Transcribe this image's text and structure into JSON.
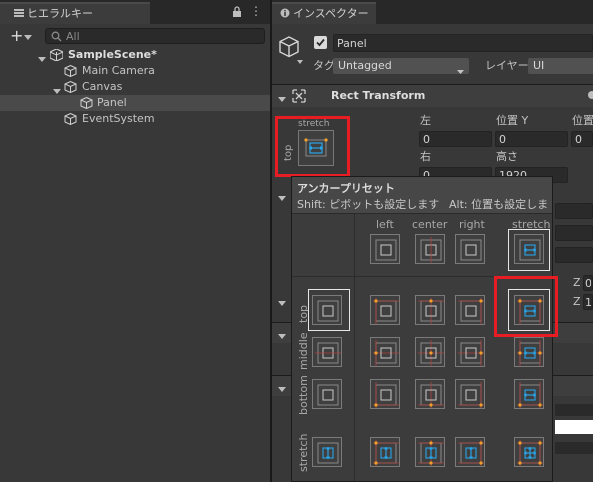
{
  "hierarchy": {
    "tab": "ヒエラルキー",
    "search_placeholder": "All",
    "items": [
      {
        "label": "SampleScene*"
      },
      {
        "label": "Main Camera"
      },
      {
        "label": "Canvas"
      },
      {
        "label": "Panel"
      },
      {
        "label": "EventSystem"
      }
    ]
  },
  "inspector": {
    "tab": "インスペクター",
    "object_name": "Panel",
    "tag_label": "タグ",
    "tag_value": "Untagged",
    "layer_label": "レイヤー",
    "layer_value": "UI",
    "component_title": "Rect Transform",
    "anchor_top_label": "top",
    "anchor_stretch_label": "stretch",
    "fields": {
      "left_label": "左",
      "left_value": "0",
      "posy_label": "位置 Y",
      "posy_value": "0",
      "posz_label": "位置",
      "posz_value": "0",
      "right_label": "右",
      "right_value": "0",
      "height_label": "高さ",
      "height_value": "1920"
    },
    "z_labels": [
      "Z",
      "Z"
    ],
    "z_values": [
      "0",
      "1"
    ]
  },
  "popup": {
    "title": "アンカープリセット",
    "hint_shift": "Shift: ピボットも設定します",
    "hint_alt": "Alt: 位置も設定しま",
    "columns": [
      "left",
      "center",
      "right",
      "stretch"
    ],
    "rows": [
      "top",
      "middle",
      "bottom",
      "stretch"
    ]
  },
  "colors": {
    "highlight": "#e81c23",
    "anchor": "#f0a02a",
    "accent": "#2aa4e8"
  }
}
